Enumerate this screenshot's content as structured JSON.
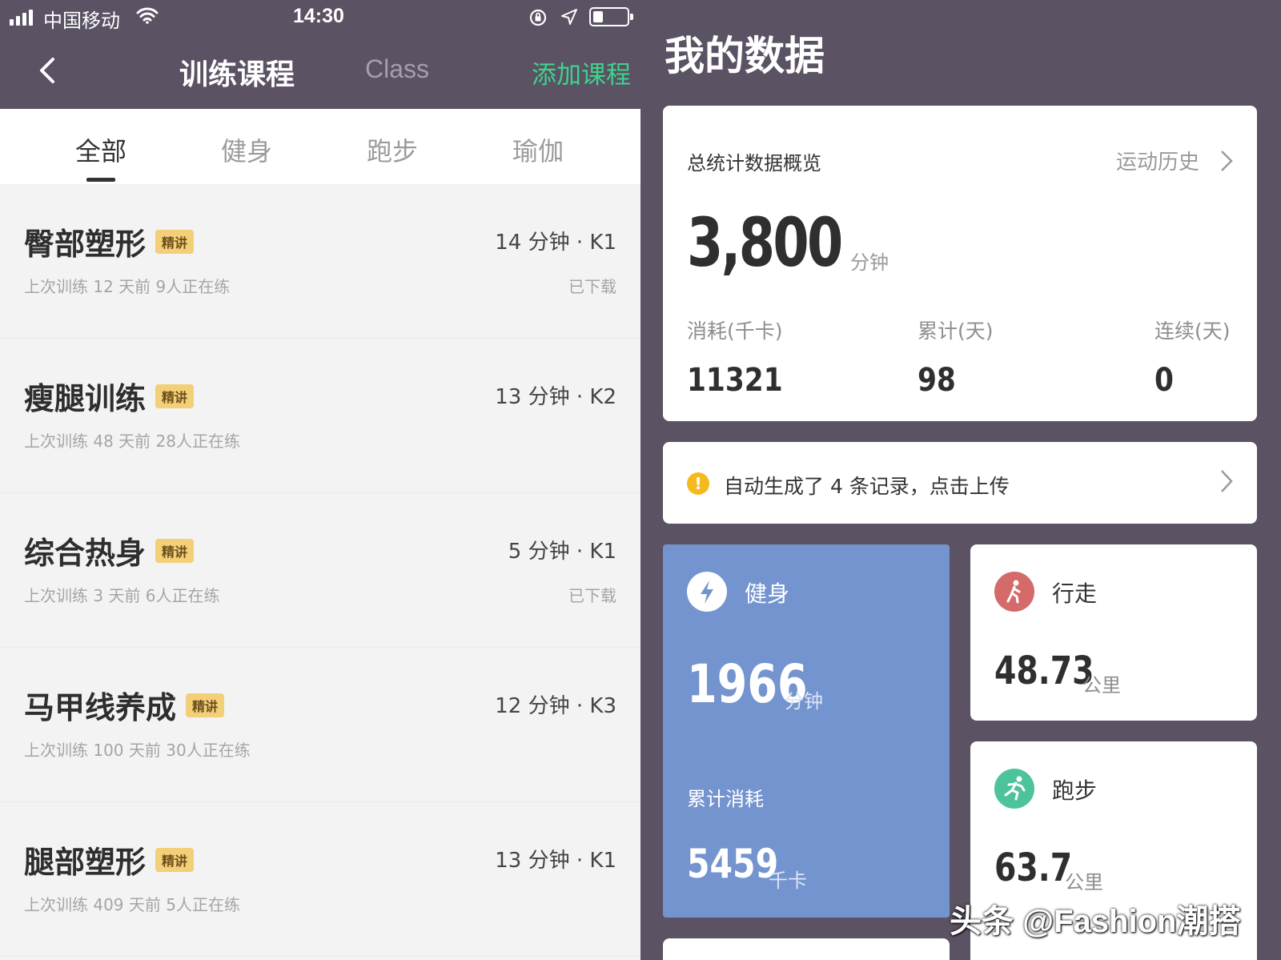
{
  "status_bar": {
    "carrier": "中国移动",
    "time": "14:30",
    "battery_level": 0.3
  },
  "left_nav": {
    "title": "训练课程",
    "class_label": "Class",
    "add_label": "添加课程"
  },
  "tabs": [
    {
      "label": "全部",
      "active": true
    },
    {
      "label": "健身",
      "active": false
    },
    {
      "label": "跑步",
      "active": false
    },
    {
      "label": "瑜伽",
      "active": false
    }
  ],
  "courses": [
    {
      "title": "臀部塑形",
      "badge": "精讲",
      "meta": "14 分钟 · K1",
      "sub": "上次训练 12 天前  9人正在练",
      "download": "已下载"
    },
    {
      "title": "瘦腿训练",
      "badge": "精讲",
      "meta": "13 分钟 · K2",
      "sub": "上次训练 48 天前  28人正在练",
      "download": ""
    },
    {
      "title": "综合热身",
      "badge": "精讲",
      "meta": "5 分钟 · K1",
      "sub": "上次训练 3 天前  6人正在练",
      "download": "已下载"
    },
    {
      "title": "马甲线养成",
      "badge": "精讲",
      "meta": "12 分钟 · K3",
      "sub": "上次训练 100 天前  30人正在练",
      "download": ""
    },
    {
      "title": "腿部塑形",
      "badge": "精讲",
      "meta": "13 分钟 · K1",
      "sub": "上次训练 409 天前  5人正在练",
      "download": ""
    }
  ],
  "my_data": {
    "title": "我的数据",
    "overview": {
      "label": "总统计数据概览",
      "history_label": "运动历史",
      "total_value": "3,800",
      "total_unit": "分钟",
      "stats": [
        {
          "label": "消耗(千卡)",
          "value": "11321"
        },
        {
          "label": "累计(天)",
          "value": "98"
        },
        {
          "label": "连续(天)",
          "value": "0"
        }
      ]
    },
    "notice": {
      "icon": "!",
      "text": "自动生成了 4 条记录，点击上传"
    },
    "fitness": {
      "name": "健身",
      "value": "1966",
      "unit": "分钟",
      "cum_label": "累计消耗",
      "cum_value": "5459",
      "cum_unit": "千卡"
    },
    "walking": {
      "name": "行走",
      "value": "48.73",
      "unit": "公里"
    },
    "running": {
      "name": "跑步",
      "value": "63.7",
      "unit": "公里"
    }
  },
  "watermark": "头条 @Fashion潮搭",
  "colors": {
    "header_bg": "#5b5263",
    "accent_green": "#3fd28d",
    "fitness_card": "#7494cf",
    "walk_icon": "#d46a6a",
    "run_icon": "#4dc39a",
    "badge": "#f3cf77",
    "notice_icon": "#f5b91e"
  }
}
